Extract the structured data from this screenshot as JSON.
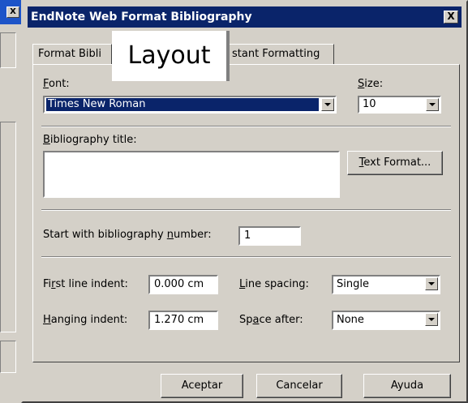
{
  "background_window": {
    "close_label": "X"
  },
  "dialog": {
    "title": "EndNote Web Format Bibliography",
    "close_label": "X"
  },
  "tabs": [
    {
      "label": "Format Bibli"
    },
    {
      "label": "Layout"
    },
    {
      "label": "stant Formatting"
    }
  ],
  "font": {
    "label_u": "F",
    "label_rest": "ont:",
    "value": "Times New Roman"
  },
  "size": {
    "label_u": "S",
    "label_rest": "ize:",
    "value": "10"
  },
  "bibliography_title": {
    "label_u": "B",
    "label_rest": "ibliography title:",
    "value": ""
  },
  "text_format_button": {
    "label_u": "T",
    "label_rest": "ext Format..."
  },
  "start_number": {
    "label_pre": "Start with bibliography ",
    "label_u": "n",
    "label_rest": "umber:",
    "value": "1"
  },
  "first_line_indent": {
    "label_pre": "Fi",
    "label_u": "r",
    "label_rest": "st line indent:",
    "value": "0.000 cm"
  },
  "hanging_indent": {
    "label_u": "H",
    "label_rest": "anging indent:",
    "value": "1.270 cm"
  },
  "line_spacing": {
    "label_u": "L",
    "label_rest": "ine spacing:",
    "value": "Single"
  },
  "space_after": {
    "label_pre": "Sp",
    "label_u": "a",
    "label_rest": "ce after:",
    "value": "None"
  },
  "buttons": {
    "accept": "Aceptar",
    "cancel": "Cancelar",
    "help": "Ayuda"
  },
  "colors": {
    "desktop": "#0A246A",
    "face": "#D4D0C8",
    "selection": "#0A246A"
  }
}
